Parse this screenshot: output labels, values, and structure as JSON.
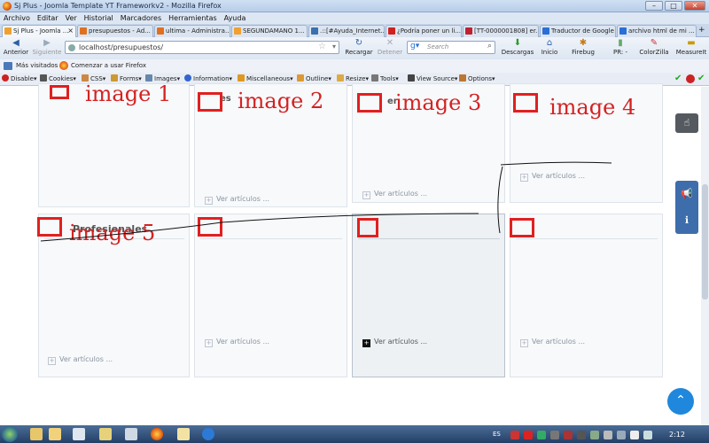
{
  "window": {
    "title": "Sj Plus - Joomla Template YT Frameworkv2 - Mozilla Firefox",
    "minimize": "–",
    "maximize": "□",
    "close": "✕"
  },
  "menu": [
    "Archivo",
    "Editar",
    "Ver",
    "Historial",
    "Marcadores",
    "Herramientas",
    "Ayuda"
  ],
  "tabs": [
    {
      "label": "Sj Plus - Joomla ...",
      "active": true,
      "color": "#f0a030"
    },
    {
      "label": "presupuestos - Ad...",
      "active": false,
      "color": "#e07020"
    },
    {
      "label": "ultima - Administra...",
      "active": false,
      "color": "#e07020"
    },
    {
      "label": "SEGUNDAMANO 1...",
      "active": false,
      "color": "#f0a030"
    },
    {
      "label": ".::[#Ayuda_Internet...",
      "active": false,
      "color": "#3a6fb0"
    },
    {
      "label": "¿Podría poner un li...",
      "active": false,
      "color": "#d02020"
    },
    {
      "label": "[TT-0000001808] er...",
      "active": false,
      "color": "#c02030"
    },
    {
      "label": "Traductor de Google",
      "active": false,
      "color": "#2a6fd6"
    },
    {
      "label": "archivo html de mi ...",
      "active": false,
      "color": "#2a6fd6"
    }
  ],
  "nav": {
    "back": "Anterior",
    "forward": "Siguiente",
    "url": "localhost/presupuestos/",
    "reload": "Recargar",
    "stop": "Detener",
    "search_placeholder": "Search",
    "downloads": "Descargas",
    "home": "Inicio",
    "firebug": "Firebug",
    "pr": "PR: -",
    "colorzilla": "ColorZilla",
    "measureit": "MeasureIt"
  },
  "bookmarks": [
    "Más visitados",
    "Comenzar a usar Firefox"
  ],
  "devtools": [
    "Disable",
    "Cookies",
    "CSS",
    "Forms",
    "Images",
    "Information",
    "Miscellaneous",
    "Outline",
    "Resize",
    "Tools",
    "View Source",
    "Options"
  ],
  "page": {
    "image_labels": [
      "image 1",
      "image 2",
      "image 3",
      "image 4",
      "image 5"
    ],
    "ver_label": "Ver artículos ...",
    "card5_title": "Profesionales",
    "card2_fragment": "es",
    "card3_fragment": "er"
  },
  "taskbar": {
    "lang": "ES",
    "clock": "2:12"
  }
}
